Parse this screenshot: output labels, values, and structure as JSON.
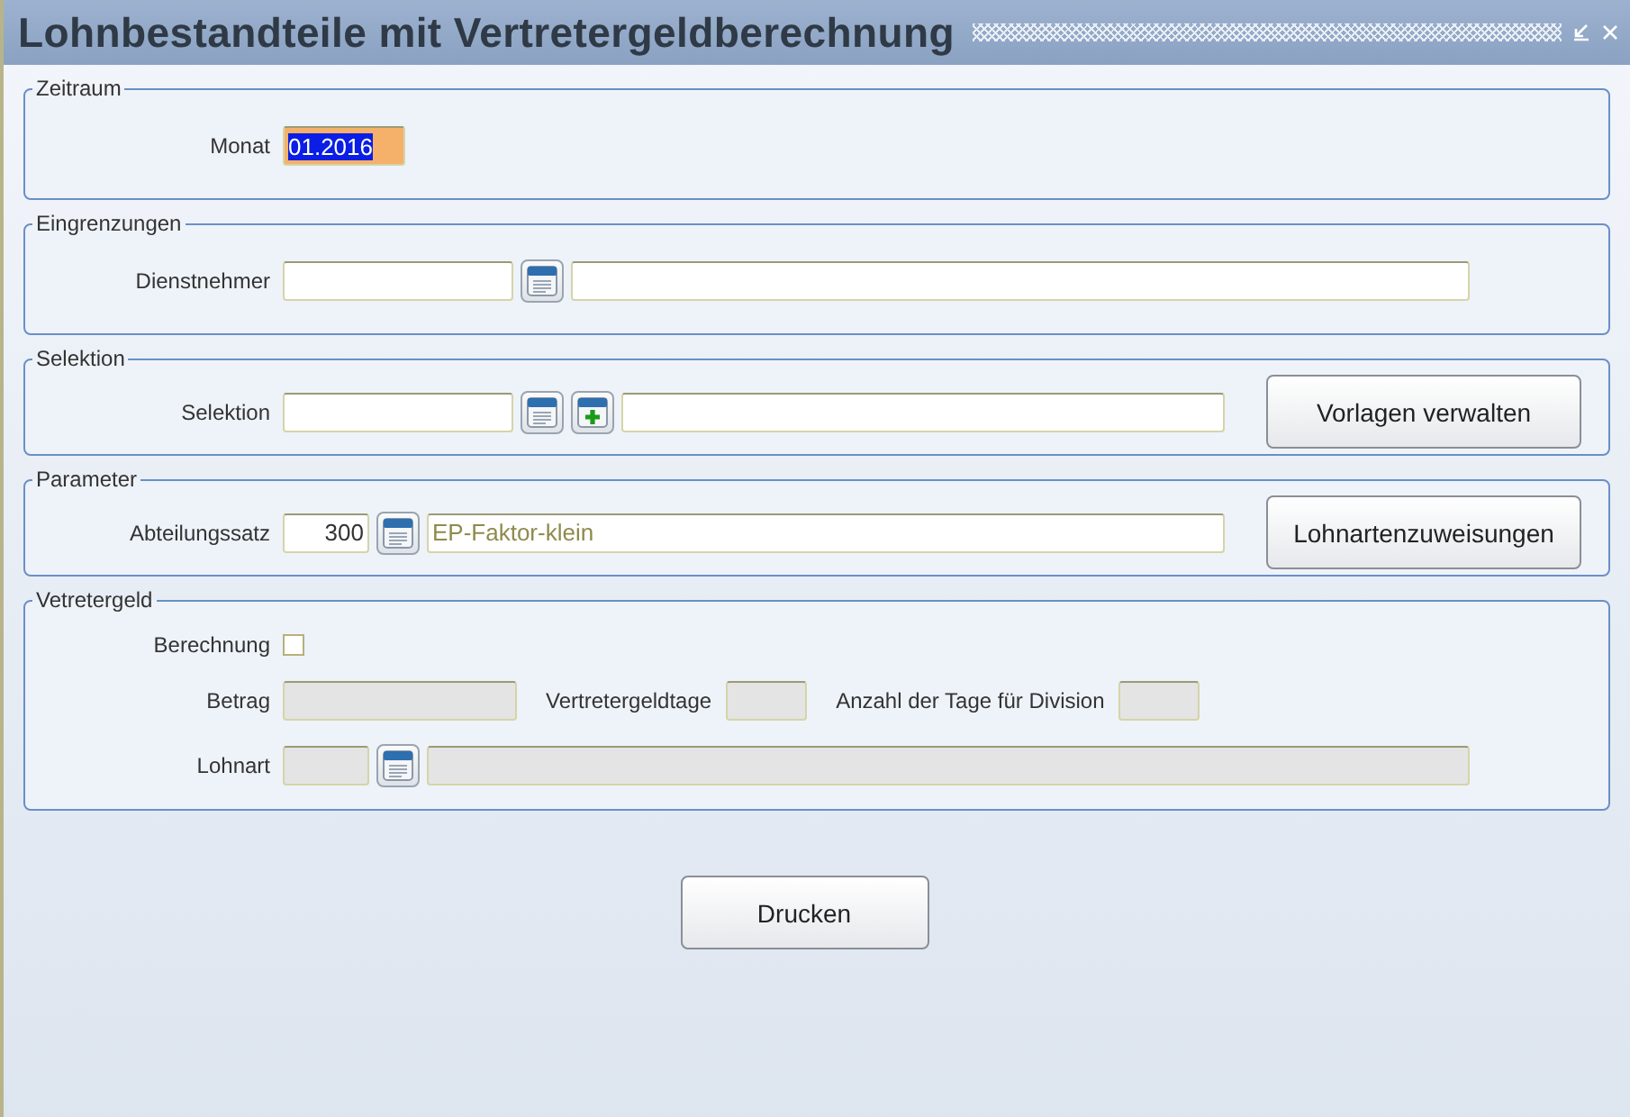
{
  "window": {
    "title": "Lohnbestandteile mit Vertretergeldberechnung"
  },
  "sections": [
    {
      "legend": "Zeitraum",
      "rows": [
        {
          "label": "Monat",
          "items": [
            {
              "kind": "month",
              "value": "01.2016",
              "selected": true
            }
          ]
        }
      ]
    },
    {
      "legend": "Eingrenzungen",
      "rows": [
        {
          "label": "Dienstnehmer",
          "items": [
            {
              "kind": "code"
            },
            {
              "kind": "lookup"
            },
            {
              "kind": "fill"
            }
          ]
        }
      ]
    },
    {
      "legend": "Selektion",
      "button": "Vorlagen verwalten",
      "rows": [
        {
          "label": "Selektion",
          "items": [
            {
              "kind": "code"
            },
            {
              "kind": "lookup"
            },
            {
              "kind": "add"
            },
            {
              "kind": "fill"
            }
          ]
        }
      ]
    },
    {
      "legend": "Parameter",
      "button": "Lohnartenzuweisungen",
      "rows": [
        {
          "label": "Abteilungssatz",
          "items": [
            {
              "kind": "number",
              "value": "300"
            },
            {
              "kind": "lookup"
            },
            {
              "kind": "fill",
              "value": "EP-Faktor-klein"
            }
          ]
        }
      ]
    },
    {
      "legend": "Vetretergeld",
      "rows": [
        {
          "label": "Berechnung",
          "items": [
            {
              "kind": "checkbox",
              "checked": false
            }
          ]
        },
        {
          "label": "Betrag",
          "items": [
            {
              "kind": "amount",
              "disabled": true
            },
            {
              "kind": "label",
              "text": "Vertretergeldtage"
            },
            {
              "kind": "days",
              "disabled": true
            },
            {
              "kind": "label",
              "text": "Anzahl der Tage für Division"
            },
            {
              "kind": "days",
              "disabled": true
            }
          ]
        },
        {
          "label": "Lohnart",
          "items": [
            {
              "kind": "number",
              "disabled": true
            },
            {
              "kind": "lookup"
            },
            {
              "kind": "fill",
              "disabled": true
            }
          ]
        }
      ]
    }
  ],
  "print_button": "Drucken"
}
